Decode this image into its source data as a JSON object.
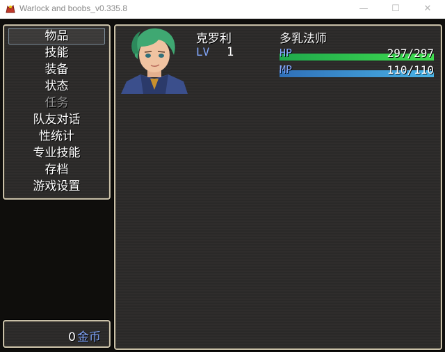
{
  "window": {
    "title": "Warlock and boobs_v0.335.8",
    "minimize": "—",
    "maximize": "☐",
    "close": "✕"
  },
  "menu": {
    "items": [
      {
        "label": "物品",
        "state": "selected"
      },
      {
        "label": "技能",
        "state": "normal"
      },
      {
        "label": "装备",
        "state": "normal"
      },
      {
        "label": "状态",
        "state": "normal"
      },
      {
        "label": "任务",
        "state": "disabled"
      },
      {
        "label": "队友对话",
        "state": "normal"
      },
      {
        "label": "性统计",
        "state": "normal"
      },
      {
        "label": "专业技能",
        "state": "normal"
      },
      {
        "label": "存档",
        "state": "normal"
      },
      {
        "label": "游戏设置",
        "state": "normal"
      }
    ]
  },
  "gold": {
    "amount": "0",
    "unit": "金币"
  },
  "actor": {
    "name": "克罗利",
    "class": "多乳法师",
    "level_label": "LV",
    "level": "1",
    "hp_label": "HP",
    "hp": "297/297",
    "hp_fraction": 1.0,
    "mp_label": "MP",
    "mp": "110/110",
    "mp_fraction": 1.0
  },
  "colors": {
    "system_text": "#84a9ff",
    "hp_gauge": [
      "#1fa84d",
      "#3fdc4e"
    ],
    "mp_gauge": [
      "#2f6fb8",
      "#49b3e6"
    ],
    "window_border": "#c9c0a8"
  }
}
